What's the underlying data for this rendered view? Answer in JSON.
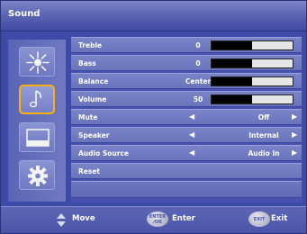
{
  "header": {
    "title": "Sound"
  },
  "categories": [
    {
      "icon": "brightness-icon",
      "selected": false
    },
    {
      "icon": "music-note-icon",
      "selected": true
    },
    {
      "icon": "screen-icon",
      "selected": false
    },
    {
      "icon": "gear-icon",
      "selected": false
    }
  ],
  "menu": {
    "treble": {
      "label": "Treble",
      "value": "0",
      "level": 0.5
    },
    "bass": {
      "label": "Bass",
      "value": "0",
      "level": 0.5
    },
    "balance": {
      "label": "Balance",
      "value": "Center",
      "level": 0.5
    },
    "volume": {
      "label": "Volume",
      "value": "50",
      "level": 0.5
    },
    "mute": {
      "label": "Mute",
      "value": "Off"
    },
    "speaker": {
      "label": "Speaker",
      "value": "Internal"
    },
    "audio_source": {
      "label": "Audio Source",
      "value": "Audio In"
    },
    "reset": {
      "label": "Reset"
    }
  },
  "footer": {
    "move_label": "Move",
    "enter_icon_text_top": "ENTER",
    "enter_icon_text_bottom": "/OK",
    "enter_label": "Enter",
    "exit_icon_text": "EXIT",
    "exit_label": "Exit"
  },
  "colors": {
    "background": "#3d4aa8",
    "selected_border": "#ffb000",
    "bar_fill": "#000000",
    "bar_track": "#e6e6e6"
  }
}
